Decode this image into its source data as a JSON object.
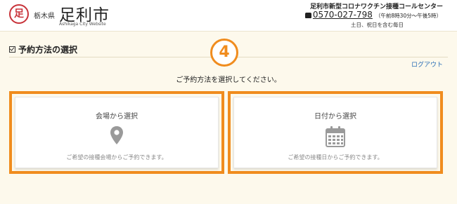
{
  "header": {
    "logo_glyph": "足",
    "prefecture": "栃木県",
    "city_name": "足利市",
    "city_name_en": "Ashikaga City Website",
    "call_center_title": "足利市新型コロナワクチン接種コールセンター",
    "phone": "0570-027-798",
    "hours": "（午前8時30分〜午後5時）",
    "days_note": "土日、祝日を含む毎日"
  },
  "page": {
    "section_title": "予約方法の選択",
    "step_number": "4",
    "logout_label": "ログアウト",
    "instruction": "ご予約方法を選択してください。"
  },
  "options": [
    {
      "title": "会場から選択",
      "icon": "map-pin-icon",
      "description": "ご希望の接種会場からご予約できます。"
    },
    {
      "title": "日付から選択",
      "icon": "calendar-icon",
      "description": "ご希望の接種日からご予約できます。"
    }
  ],
  "colors": {
    "highlight": "#f08c1e",
    "background": "#fdf9ec",
    "link": "#2b6fb6",
    "icon": "#9a9a9a",
    "brand_red": "#c8333a"
  }
}
